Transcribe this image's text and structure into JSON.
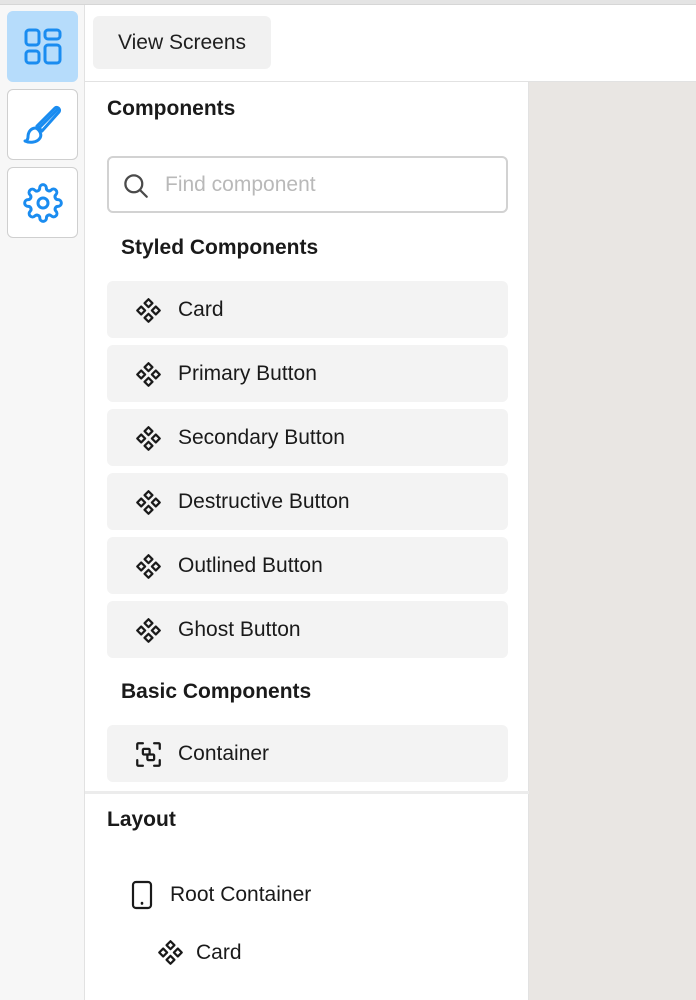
{
  "rail": {
    "items": [
      {
        "icon": "grid-icon",
        "active": true
      },
      {
        "icon": "brush-icon",
        "active": false
      },
      {
        "icon": "gear-icon",
        "active": false
      }
    ]
  },
  "toolbar": {
    "view_screens_label": "View Screens"
  },
  "components_panel": {
    "title": "Components",
    "search": {
      "placeholder": "Find component",
      "value": ""
    },
    "styled_section": {
      "title": "Styled Components",
      "items": [
        "Card",
        "Primary Button",
        "Secondary Button",
        "Destructive Button",
        "Outlined Button",
        "Ghost Button"
      ]
    },
    "basic_section": {
      "title": "Basic Components",
      "items": [
        "Container"
      ]
    }
  },
  "layout_panel": {
    "title": "Layout",
    "tree": [
      {
        "label": "Root Container",
        "icon": "device-icon"
      },
      {
        "label": "Card",
        "icon": "component-icon"
      }
    ]
  },
  "colors": {
    "accent": "#1a8cf0",
    "active_rail_bg": "#b6dcfb",
    "canvas_bg": "#e9e6e3"
  }
}
